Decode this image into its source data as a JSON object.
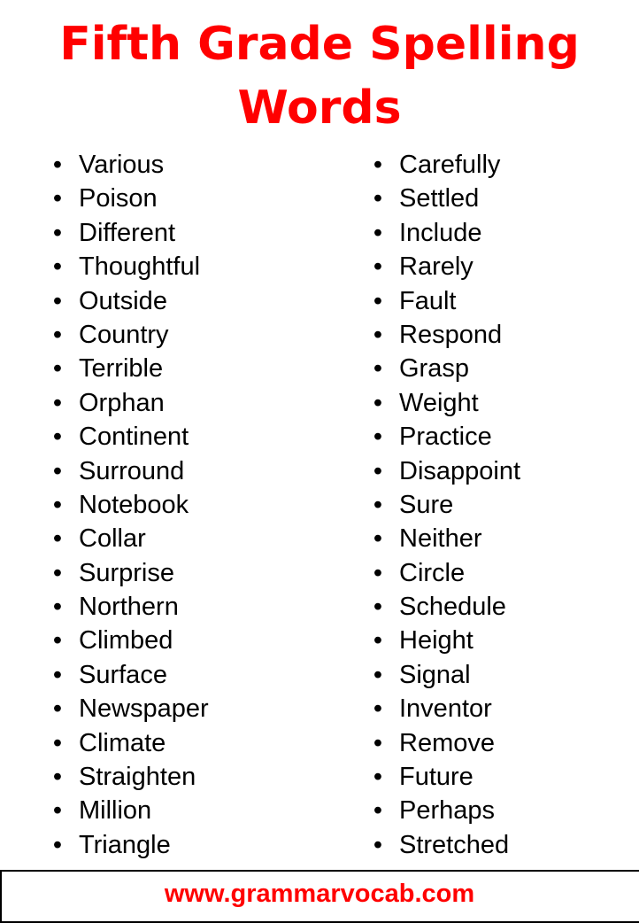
{
  "title": {
    "line1": "Fifth Grade Spelling",
    "line2": "Words"
  },
  "bullet_glyph": "•",
  "left_column": [
    "Various",
    "Poison",
    "Different",
    "Thoughtful",
    "Outside",
    "Country",
    "Terrible",
    "Orphan",
    "Continent",
    "Surround",
    "Notebook",
    "Collar",
    "Surprise",
    "Northern",
    "Climbed",
    "Surface",
    "Newspaper",
    "Climate",
    "Straighten",
    "Million",
    "Triangle"
  ],
  "right_column": [
    "Carefully",
    "Settled",
    "Include",
    "Rarely",
    "Fault",
    "Respond",
    "Grasp",
    "Weight",
    "Practice",
    "Disappoint",
    "Sure",
    "Neither",
    "Circle",
    "Schedule",
    "Height",
    "Signal",
    "Inventor",
    "Remove",
    "Future",
    "Perhaps",
    "Stretched"
  ],
  "footer": {
    "website": "www.grammarvocab.com"
  },
  "colors": {
    "accent": "#ff0000",
    "text": "#000000",
    "background": "#ffffff"
  }
}
